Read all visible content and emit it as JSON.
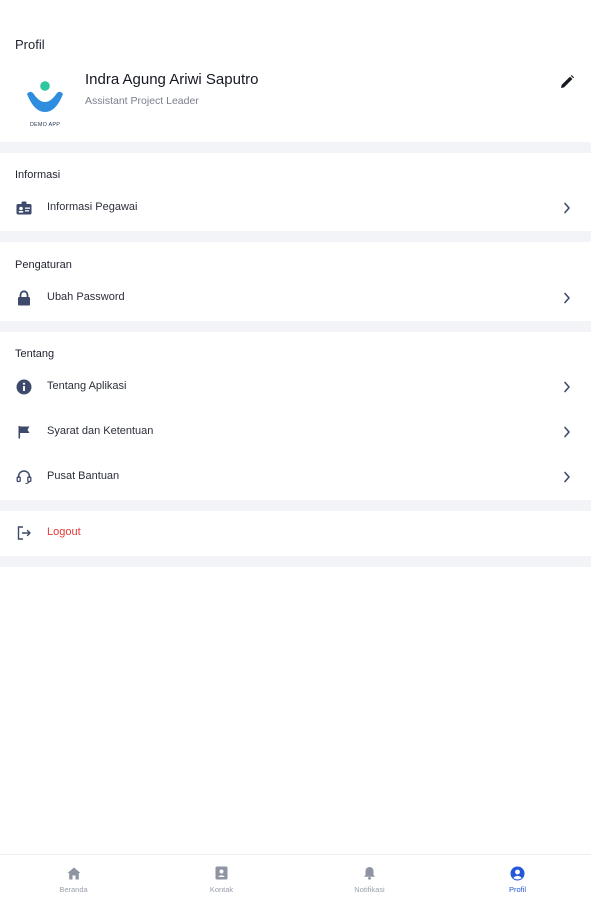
{
  "header": {
    "title": "Profil"
  },
  "profile": {
    "logo_text": "DEMO APP",
    "name": "Indra Agung Ariwi Saputro",
    "role": "Assistant Project Leader",
    "edit_icon": "pencil-icon"
  },
  "sections": {
    "informasi": {
      "title": "Informasi",
      "items": [
        {
          "label": "Informasi Pegawai",
          "icon": "id-badge-icon"
        }
      ]
    },
    "pengaturan": {
      "title": "Pengaturan",
      "items": [
        {
          "label": "Ubah Password",
          "icon": "lock-icon"
        }
      ]
    },
    "tentang": {
      "title": "Tentang",
      "items": [
        {
          "label": "Tentang Aplikasi",
          "icon": "info-icon"
        },
        {
          "label": "Syarat dan Ketentuan",
          "icon": "flag-icon"
        },
        {
          "label": "Pusat Bantuan",
          "icon": "headset-icon"
        }
      ]
    }
  },
  "logout": {
    "label": "Logout",
    "icon": "logout-icon",
    "color": "#e53935"
  },
  "bottom_nav": {
    "items": [
      {
        "label": "Beranda",
        "icon": "home-icon",
        "active": false
      },
      {
        "label": "Kontak",
        "icon": "contact-book-icon",
        "active": false
      },
      {
        "label": "Notifikasi",
        "icon": "bell-icon",
        "active": false
      },
      {
        "label": "Profil",
        "icon": "user-circle-icon",
        "active": true
      }
    ]
  },
  "colors": {
    "accent": "#2458d8",
    "icon": "#3d4a6b",
    "danger": "#e53935",
    "divider": "#f3f4f7",
    "logo_teal": "#2ec7a0",
    "logo_blue": "#2f8de0"
  }
}
